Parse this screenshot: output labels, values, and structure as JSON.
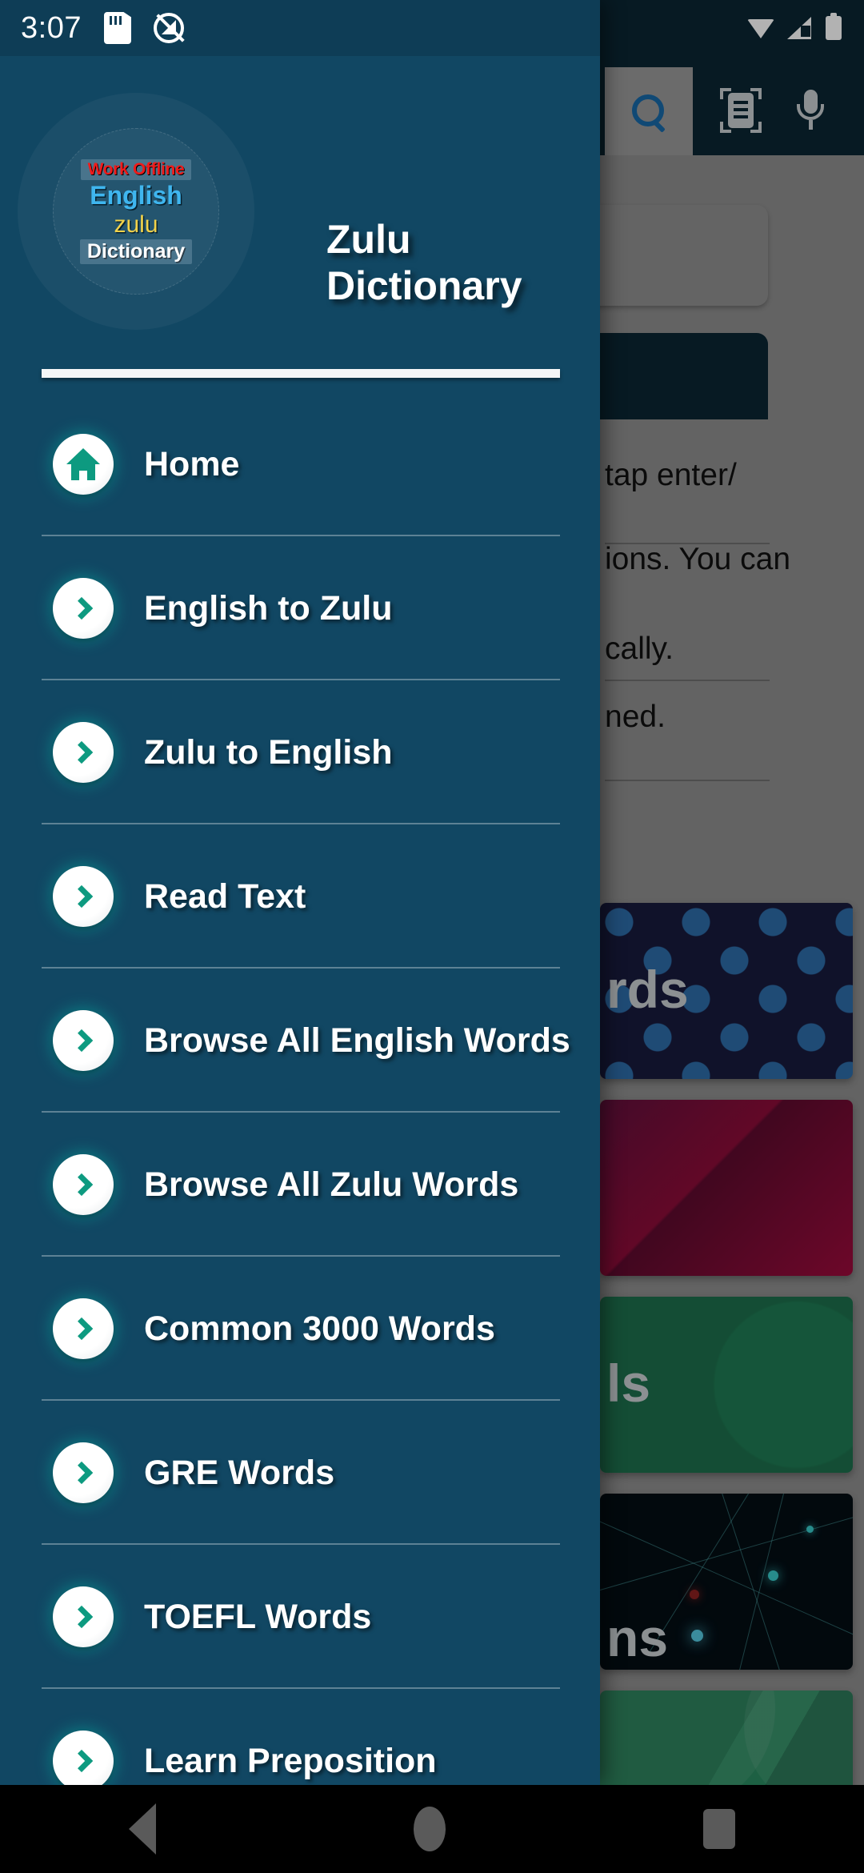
{
  "status_bar": {
    "time": "3:07",
    "left_icons": [
      "sd-card-icon",
      "location-off-icon"
    ],
    "right_icons": [
      "wifi-icon",
      "cellular-signal-icon",
      "battery-icon"
    ]
  },
  "drawer": {
    "logo": {
      "line1": "Work Offline",
      "line2": "English",
      "line3": "zulu",
      "line4": "Dictionary",
      "colors": {
        "offline": "#f01b1b",
        "english": "#3fb6ef",
        "zulu": "#f2d24a",
        "dictionary": "#ffffff"
      }
    },
    "title_line1": "Zulu",
    "title_line2": "Dictionary",
    "background_color": "#114763",
    "accent_color": "#0d9a80",
    "items": [
      {
        "label": "Home",
        "icon": "home-icon"
      },
      {
        "label": "English to Zulu",
        "icon": "chevron-right-icon"
      },
      {
        "label": "Zulu to English",
        "icon": "chevron-right-icon"
      },
      {
        "label": "Read Text",
        "icon": "chevron-right-icon"
      },
      {
        "label": "Browse All English Words",
        "icon": "chevron-right-icon"
      },
      {
        "label": "Browse All Zulu Words",
        "icon": "chevron-right-icon"
      },
      {
        "label": "Common 3000 Words",
        "icon": "chevron-right-icon"
      },
      {
        "label": "GRE Words",
        "icon": "chevron-right-icon"
      },
      {
        "label": "TOEFL Words",
        "icon": "chevron-right-icon"
      },
      {
        "label": "Learn Preposition",
        "icon": "chevron-right-icon"
      }
    ]
  },
  "background_app": {
    "toolbar": {
      "search_icon": "search-icon",
      "scan_text_icon": "scan-text-icon",
      "voice_search_icon": "microphone-icon"
    },
    "text_fragments": [
      "tap enter/",
      "ions. You can",
      "cally.",
      "ned."
    ],
    "cards": [
      {
        "label": "rds",
        "theme": "dotted-navy"
      },
      {
        "label": "",
        "theme": "crimson"
      },
      {
        "label": "ls",
        "theme": "green"
      },
      {
        "label": "ns",
        "theme": "network-dark"
      },
      {
        "label": "",
        "theme": "green-shapes"
      }
    ]
  },
  "navigation_bar": {
    "back": "back-button",
    "home": "home-button",
    "recents": "recents-button"
  }
}
